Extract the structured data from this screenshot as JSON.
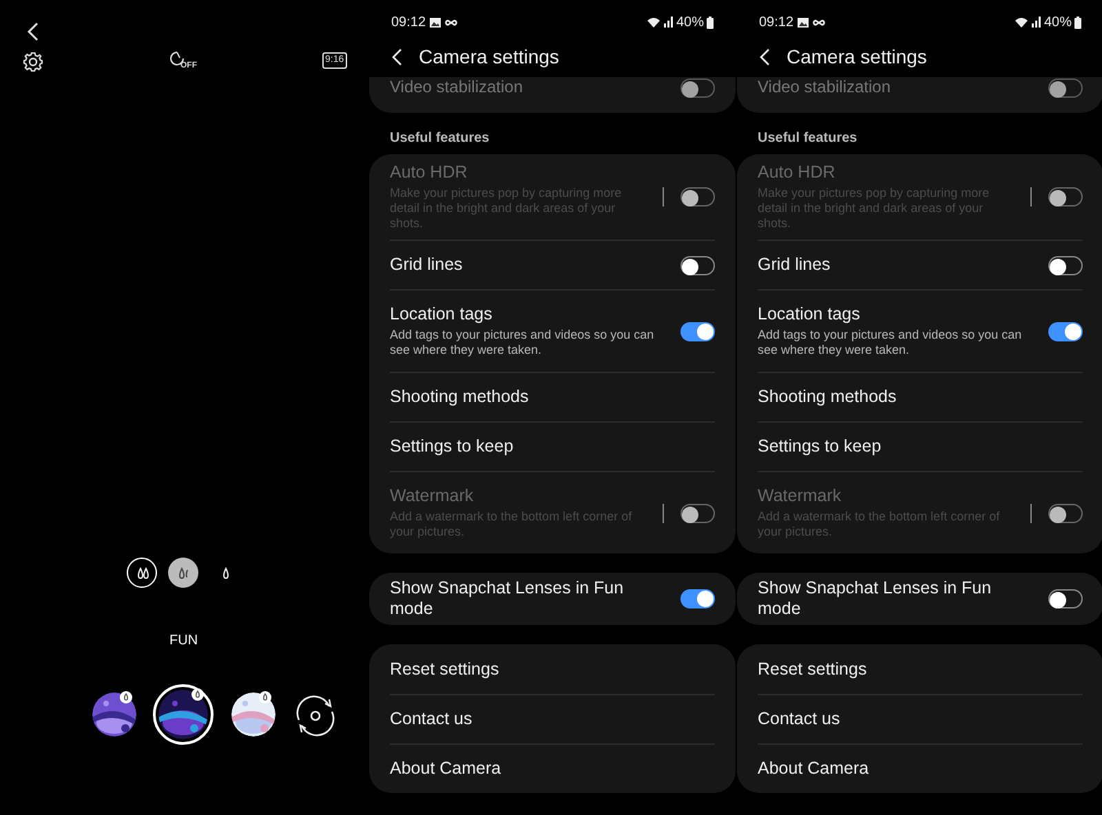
{
  "camera": {
    "timer": {
      "label": "OFF"
    },
    "ratio": {
      "label": "9:16"
    },
    "filters": [
      {
        "selected": false
      },
      {
        "selected": true
      },
      {
        "selected": false
      }
    ],
    "mode": "FUN",
    "lenses": [
      {
        "selected": false
      },
      {
        "selected": true
      },
      {
        "selected": false
      }
    ]
  },
  "settings_screens": [
    {
      "status_bar": {
        "time": "09:12",
        "battery": "40%"
      },
      "title": "Camera settings",
      "top_item": {
        "label": "Video stabilization",
        "on": false
      },
      "section": "Useful features",
      "groups": [
        [
          {
            "kind": "toggle",
            "label": "Auto HDR",
            "description": "Make your pictures pop by capturing more detail in the bright and dark areas of your shots.",
            "disabled": true,
            "on": false
          },
          {
            "kind": "toggle",
            "label": "Grid lines",
            "disabled": false,
            "on": false
          },
          {
            "kind": "toggle",
            "label": "Location tags",
            "description": "Add tags to your pictures and videos so you can see where they were taken.",
            "disabled": false,
            "on": true
          },
          {
            "kind": "link",
            "label": "Shooting methods"
          },
          {
            "kind": "link",
            "label": "Settings to keep"
          },
          {
            "kind": "toggle",
            "label": "Watermark",
            "description": "Add a watermark to the bottom left corner of your pictures.",
            "disabled": true,
            "on": false
          }
        ],
        [
          {
            "kind": "toggle",
            "label": "Show Snapchat Lenses in Fun mode",
            "disabled": false,
            "on": true
          }
        ],
        [
          {
            "kind": "link",
            "label": "Reset settings"
          },
          {
            "kind": "link",
            "label": "Contact us"
          },
          {
            "kind": "link",
            "label": "About Camera"
          }
        ]
      ]
    },
    {
      "status_bar": {
        "time": "09:12",
        "battery": "40%"
      },
      "title": "Camera settings",
      "top_item": {
        "label": "Video stabilization",
        "on": false
      },
      "section": "Useful features",
      "groups": [
        [
          {
            "kind": "toggle",
            "label": "Auto HDR",
            "description": "Make your pictures pop by capturing more detail in the bright and dark areas of your shots.",
            "disabled": true,
            "on": false
          },
          {
            "kind": "toggle",
            "label": "Grid lines",
            "disabled": false,
            "on": false
          },
          {
            "kind": "toggle",
            "label": "Location tags",
            "description": "Add tags to your pictures and videos so you can see where they were taken.",
            "disabled": false,
            "on": true
          },
          {
            "kind": "link",
            "label": "Shooting methods"
          },
          {
            "kind": "link",
            "label": "Settings to keep"
          },
          {
            "kind": "toggle",
            "label": "Watermark",
            "description": "Add a watermark to the bottom left corner of your pictures.",
            "disabled": true,
            "on": false
          }
        ],
        [
          {
            "kind": "toggle",
            "label": "Show Snapchat Lenses in Fun mode",
            "disabled": false,
            "on": false
          }
        ],
        [
          {
            "kind": "link",
            "label": "Reset settings"
          },
          {
            "kind": "link",
            "label": "Contact us"
          },
          {
            "kind": "link",
            "label": "About Camera"
          }
        ]
      ]
    }
  ]
}
